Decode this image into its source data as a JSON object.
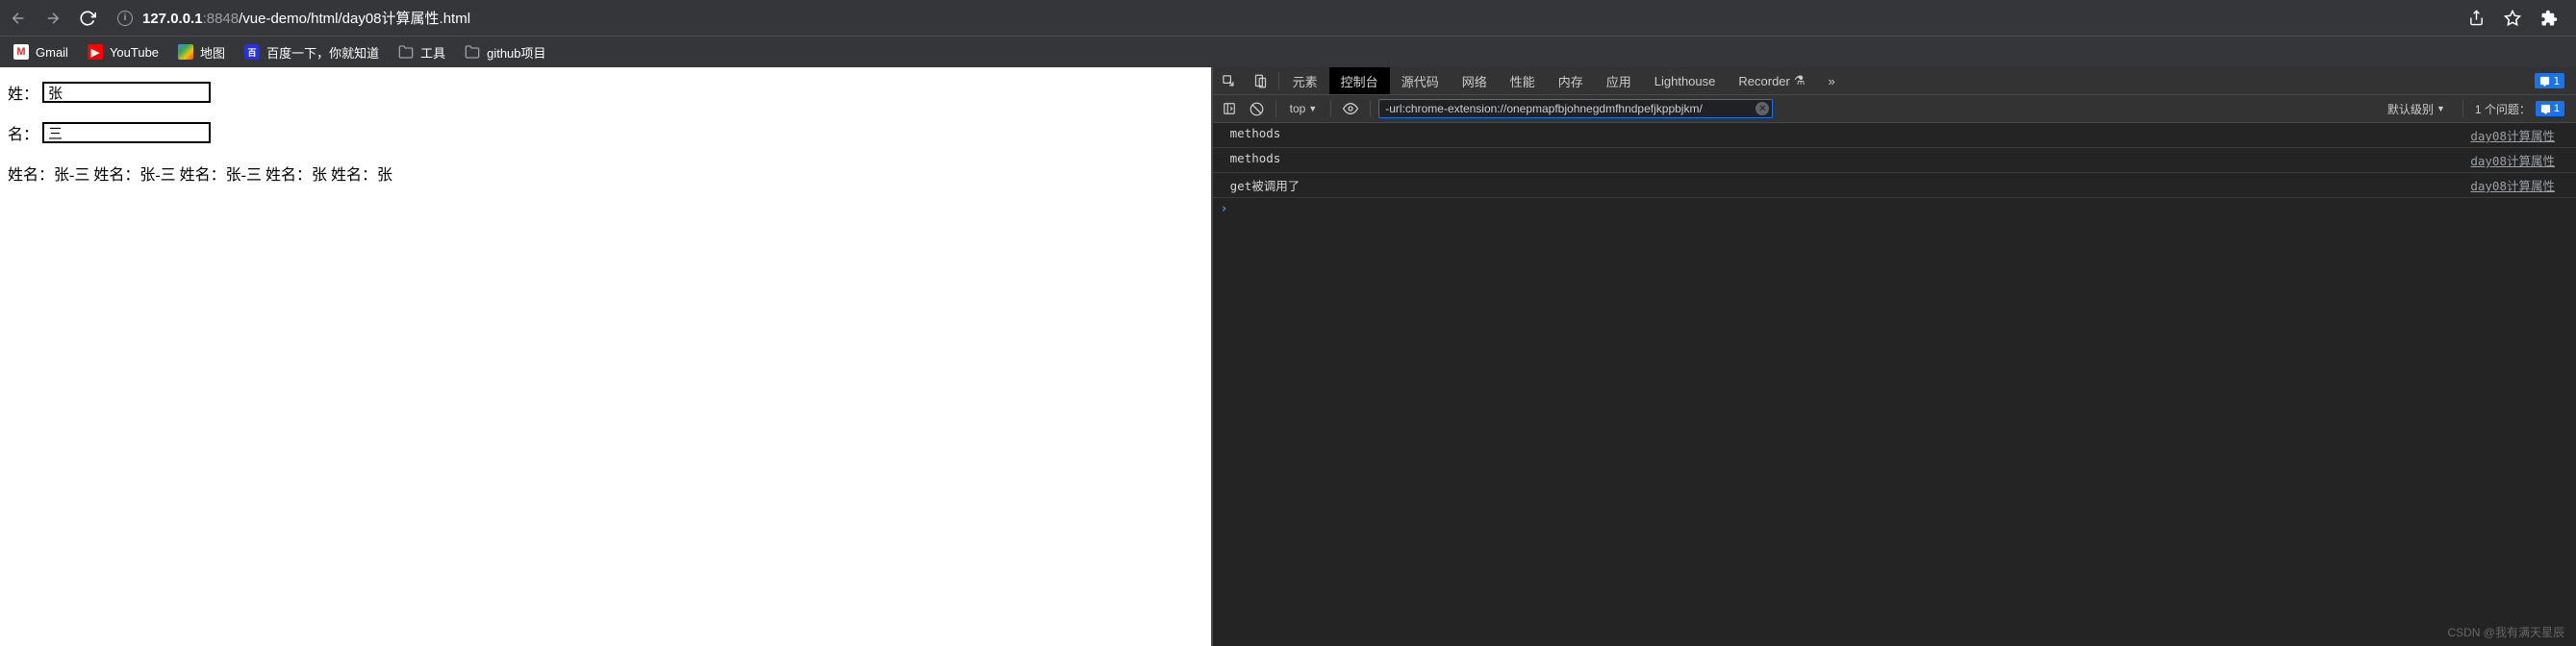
{
  "browser": {
    "url_host": "127.0.0.1",
    "url_port": ":8848",
    "url_path": "/vue-demo/html/day08计算属性.html"
  },
  "bookmarks": [
    {
      "label": "Gmail",
      "icon": "gmail"
    },
    {
      "label": "YouTube",
      "icon": "youtube"
    },
    {
      "label": "地图",
      "icon": "maps"
    },
    {
      "label": "百度一下，你就知道",
      "icon": "baidu"
    },
    {
      "label": "工具",
      "icon": "folder"
    },
    {
      "label": "github项目",
      "icon": "folder"
    }
  ],
  "page": {
    "label_surname": "姓：",
    "input_surname": "张",
    "label_given": "名：",
    "input_given": "三",
    "output": "姓名：张-三 姓名：张-三 姓名：张-三 姓名：张 姓名：张"
  },
  "devtools": {
    "tabs": [
      "元素",
      "控制台",
      "源代码",
      "网络",
      "性能",
      "内存",
      "应用",
      "Lighthouse",
      "Recorder"
    ],
    "active_tab": "控制台",
    "recorder_badge": "⚗",
    "more_tabs": "»",
    "issue_badge": "1",
    "context_label": "top",
    "filter_value": "-url:chrome-extension://onepmapfbjohnegdmfhndpefjkppbjkm/",
    "level_label": "默认级别",
    "issues_label": "1 个问题：",
    "issues_count": "1",
    "logs": [
      {
        "msg": "methods",
        "src": "day08计算属性"
      },
      {
        "msg": "methods",
        "src": "day08计算属性"
      },
      {
        "msg": "get被调用了",
        "src": "day08计算属性"
      }
    ]
  },
  "watermark": "CSDN @我有满天星辰"
}
